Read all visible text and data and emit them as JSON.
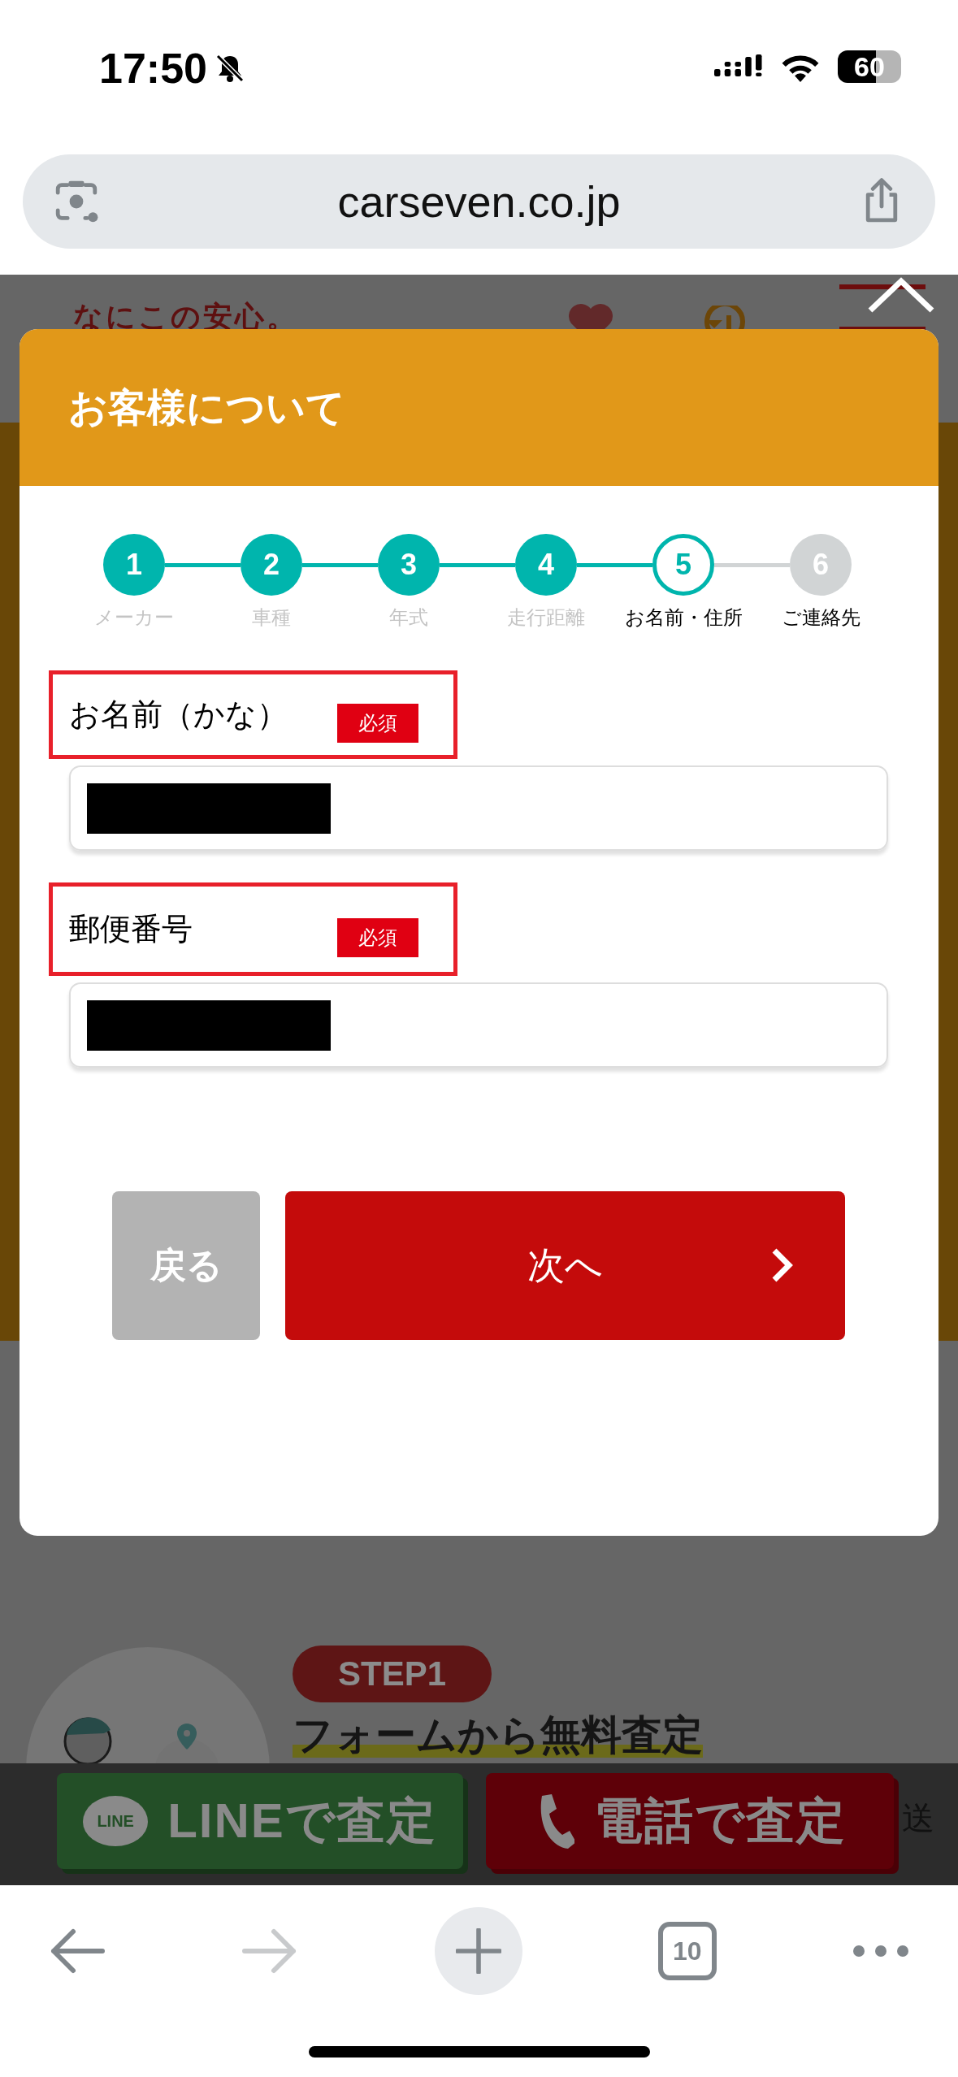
{
  "status_bar": {
    "time": "17:50",
    "battery": "60"
  },
  "browser": {
    "url": "carseven.co.jp",
    "tab_count": "10"
  },
  "background_page": {
    "tagline": "なにこの安心。",
    "step_badge": "STEP1",
    "step_title": "フォームから無料査定",
    "text_fragment": "送",
    "line_button": {
      "logo": "LINE",
      "label": "LINEで査定"
    },
    "phone_button": {
      "label": "電話で査定"
    }
  },
  "modal": {
    "title": "お客様について",
    "steps": [
      {
        "number": "1",
        "label": "メーカー",
        "completed": true,
        "current": false
      },
      {
        "number": "2",
        "label": "車種",
        "completed": true,
        "current": false
      },
      {
        "number": "3",
        "label": "年式",
        "completed": true,
        "current": false
      },
      {
        "number": "4",
        "label": "走行距離",
        "completed": true,
        "current": false
      },
      {
        "number": "5",
        "label": "お名前・住所",
        "completed": false,
        "current": true
      },
      {
        "number": "6",
        "label": "ご連絡先",
        "completed": false,
        "current": false
      }
    ],
    "fields": [
      {
        "label": "お名前（かな）",
        "badge": "必須",
        "value_redacted": true
      },
      {
        "label": "郵便番号",
        "badge": "必須",
        "value_redacted": true
      }
    ],
    "back_button": "戻る",
    "next_button": "次へ"
  }
}
